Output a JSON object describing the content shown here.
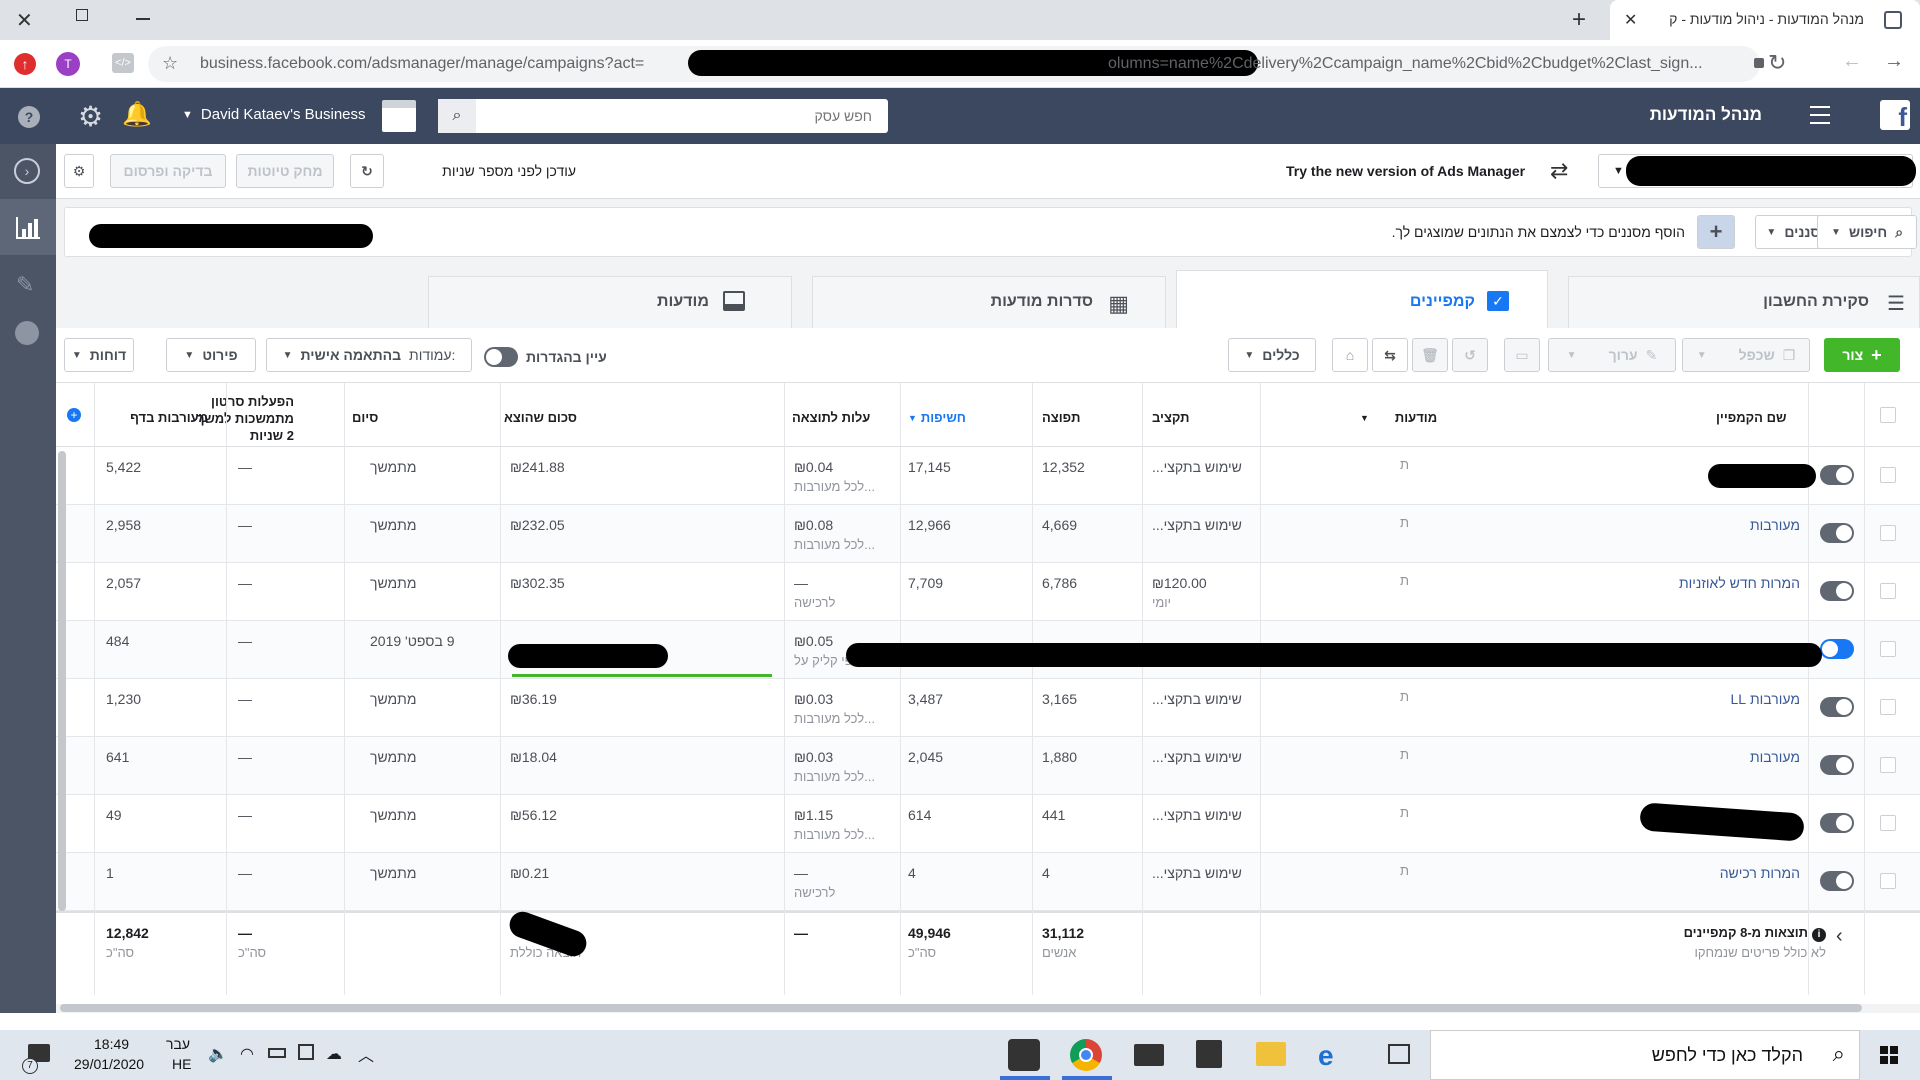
{
  "browser": {
    "tab_title": "מנהל המודעות - ניהול מודעות - ק",
    "url": "business.facebook.com/adsmanager/manage/campaigns?act=",
    "url_tail": "olumns=name%2Cdelivery%2Ccampaign_name%2Cbid%2Cbudget%2Clast_sign...",
    "profile_initial": "T"
  },
  "header": {
    "app_title": "מנהל המודעות",
    "business_name": "David Kataev's Business",
    "search_placeholder": "חפש עסק"
  },
  "toolbar": {
    "updated_text": "עודכן לפני מספר שניות",
    "discard_drafts": "מחק טיוטות",
    "review_publish": "בדיקה ופרסום",
    "try_new": "Try the new version of Ads Manager"
  },
  "filterbar": {
    "search_label": "חיפוש",
    "filters_label": "מסננים",
    "hint": "הוסף מסננים כדי לצמצם את הנתונים שמוצגים לך."
  },
  "tabs": {
    "account_overview": "סקירת החשבון",
    "campaigns": "קמפיינים",
    "ad_sets": "סדרות מודעות",
    "ads": "מודעות"
  },
  "actions": {
    "create": "צור",
    "duplicate": "שכפל",
    "edit": "ערוך",
    "rules": "כללים",
    "view_setup": "עיין בהגדרות",
    "columns_prefix": "עמודות:",
    "columns_value": "בהתאמה אישית",
    "breakdown": "פירוט",
    "reports": "דוחות"
  },
  "columns": {
    "campaign_name": "שם הקמפיין",
    "ads": "מודעות",
    "budget": "תקציב",
    "reach": "תפוצה",
    "impressions": "חשיפות",
    "cost_per_result": "עלות לתוצאה",
    "amount_spent": "סכום שהוצא",
    "ends": "סיום",
    "video_plays_line1": "הפעלות סרטון",
    "video_plays_line2": "מתמשכות למשך",
    "video_plays_line3": "2 שניות",
    "page_engagement": "מעורבות בדף"
  },
  "rows": [
    {
      "name": "",
      "ads": "ת",
      "budget": "שימוש בתקצי...",
      "budget_sub": "",
      "reach": "12,352",
      "impressions": "17,145",
      "cost": "₪0.04",
      "cost_sub": "לכל מעורבות...",
      "spent": "₪241.88",
      "ends": "מתמשך",
      "video": "—",
      "engagement": "5,422",
      "active": false
    },
    {
      "name": "מעורבות",
      "ads": "ת",
      "budget": "שימוש בתקצי...",
      "budget_sub": "",
      "reach": "4,669",
      "impressions": "12,966",
      "cost": "₪0.08",
      "cost_sub": "לכל מעורבות...",
      "spent": "₪232.05",
      "ends": "מתמשך",
      "video": "—",
      "engagement": "2,958",
      "active": false
    },
    {
      "name": "המרות חדש לאוזניות",
      "ads": "ת",
      "budget": "₪120.00",
      "budget_sub": "יומי",
      "reach": "6,786",
      "impressions": "7,709",
      "cost": "—",
      "cost_sub": "לרכישה",
      "spent": "₪302.35",
      "ends": "מתמשך",
      "video": "—",
      "engagement": "2,057",
      "active": false
    },
    {
      "name": "",
      "ads": "",
      "budget": "",
      "budget_sub": "",
      "reach": "",
      "impressions": "",
      "cost": "₪0.05",
      "cost_sub": "לפי קליק על",
      "spent": "",
      "ends": "9 בספט' 2019",
      "video": "—",
      "engagement": "484",
      "active": true
    },
    {
      "name": "מעורבות LL",
      "ads": "ת",
      "budget": "שימוש בתקצי...",
      "budget_sub": "",
      "reach": "3,165",
      "impressions": "3,487",
      "cost": "₪0.03",
      "cost_sub": "לכל מעורבות...",
      "spent": "₪36.19",
      "ends": "מתמשך",
      "video": "—",
      "engagement": "1,230",
      "active": false
    },
    {
      "name": "מעורבות",
      "ads": "ת",
      "budget": "שימוש בתקצי...",
      "budget_sub": "",
      "reach": "1,880",
      "impressions": "2,045",
      "cost": "₪0.03",
      "cost_sub": "לכל מעורבות...",
      "spent": "₪18.04",
      "ends": "מתמשך",
      "video": "—",
      "engagement": "641",
      "active": false
    },
    {
      "name": "",
      "ads": "ת",
      "budget": "שימוש בתקצי...",
      "budget_sub": "",
      "reach": "441",
      "impressions": "614",
      "cost": "₪1.15",
      "cost_sub": "לכל מעורבות...",
      "spent": "₪56.12",
      "ends": "מתמשך",
      "video": "—",
      "engagement": "49",
      "active": false
    },
    {
      "name": "המרות רכישה",
      "ads": "ת",
      "budget": "שימוש בתקצי...",
      "budget_sub": "",
      "reach": "4",
      "impressions": "4",
      "cost": "—",
      "cost_sub": "לרכישה",
      "spent": "₪0.21",
      "ends": "מתמשך",
      "video": "—",
      "engagement": "1",
      "active": false
    }
  ],
  "totals": {
    "title": "תוצאות מ-8 קמפיינים",
    "subtitle": "לא כולל פריטים שנמחקו",
    "reach": "31,112",
    "reach_sub": "אנשים",
    "impressions": "49,946",
    "impressions_sub": "סה\"כ",
    "cost": "—",
    "spent_sub": "הוצאה כוללת",
    "video": "—",
    "video_sub": "סה\"כ",
    "engagement": "12,842",
    "engagement_sub": "סה\"כ"
  },
  "taskbar": {
    "search_placeholder": "הקלד כאן כדי לחפש",
    "time": "18:49",
    "date": "29/01/2020",
    "lang_top": "עבר",
    "lang_bottom": "HE",
    "notification_count": "7"
  },
  "colors": {
    "fb_header": "#3b4860",
    "left_nav": "#4b5566",
    "create_green": "#42b72a",
    "link_blue": "#385898",
    "toggle_on": "#1877f2"
  }
}
